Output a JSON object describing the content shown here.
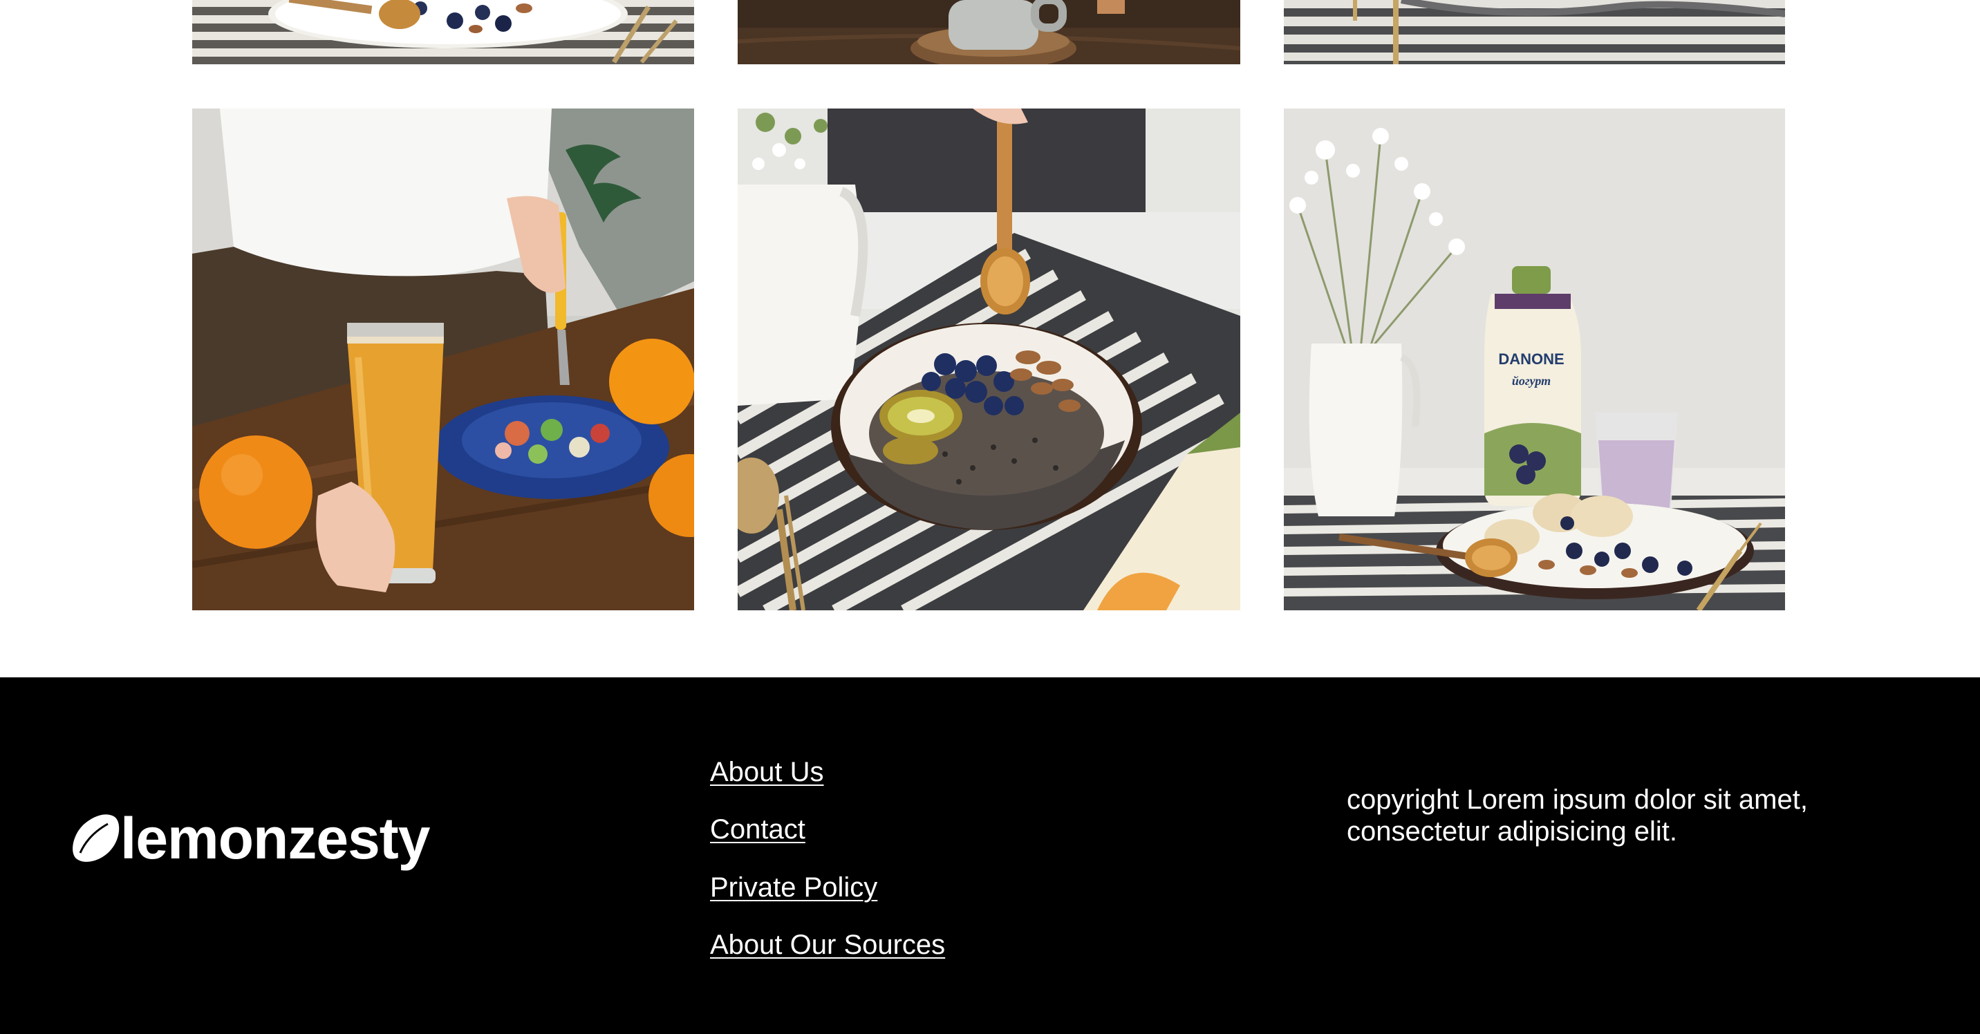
{
  "gallery": {
    "photos": [
      {
        "name": "breakfast-plate-photo",
        "alt": "Plate with blueberries, almonds and honey dipper on striped cloth"
      },
      {
        "name": "coffee-mug-photo",
        "alt": "Mug on a wooden table"
      },
      {
        "name": "striped-cloth-photo",
        "alt": "Striped napkin with golden fork"
      },
      {
        "name": "orange-juice-photo",
        "alt": "Person holding a glass of orange juice next to a salad and oranges"
      },
      {
        "name": "chia-bowl-photo",
        "alt": "Bowl of chia with blueberries, kiwi and almonds with honey dipper"
      },
      {
        "name": "yogurt-bottle-photo",
        "alt": "Yogurt bottle with flowers, smoothie and pancakes"
      }
    ],
    "bottle_brand": "DANONE",
    "bottle_subtitle": "йогурт"
  },
  "footer": {
    "logo_text": "lemonzesty",
    "logo_icon": "lemon-icon",
    "links": [
      "About Us",
      "Contact",
      "Private Policy",
      "About Our Sources"
    ],
    "copyright": "copyright Lorem ipsum dolor sit amet, consectetur adipisicing elit."
  },
  "colors": {
    "footer_background": "#000000",
    "footer_text": "#ffffff",
    "page_background": "#ffffff"
  }
}
